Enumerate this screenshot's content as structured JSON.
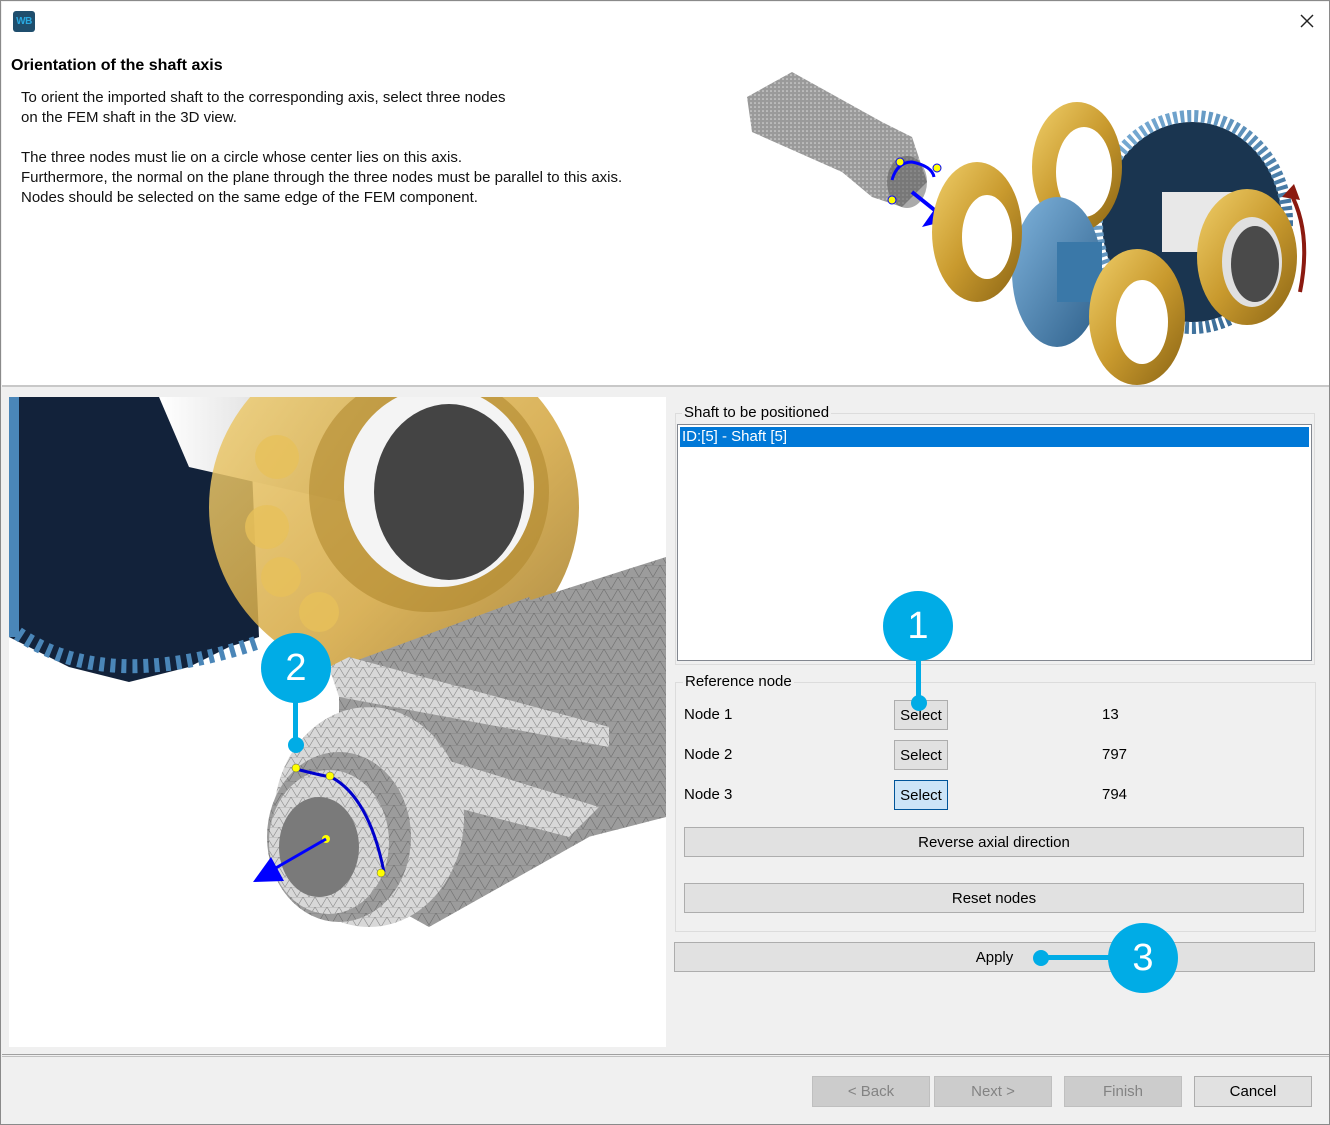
{
  "window": {
    "app_icon_text": "WB",
    "close_icon": "close-icon"
  },
  "header": {
    "title": "Orientation of the shaft axis",
    "description": [
      "To orient the imported shaft to the corresponding axis, select three nodes",
      "on the FEM shaft in the 3D view.",
      "",
      "The three nodes must lie on a circle whose center lies on this axis.",
      "Furthermore, the normal on the plane through the three nodes must be parallel to this axis.",
      "Nodes should be selected on the same edge of the FEM component."
    ]
  },
  "shaft_group": {
    "label": "Shaft to be positioned",
    "items": [
      {
        "label": "ID:[5] - Shaft [5]",
        "selected": true
      }
    ]
  },
  "reference_node": {
    "label": "Reference node",
    "nodes": [
      {
        "label": "Node 1",
        "button": "Select",
        "value": "13"
      },
      {
        "label": "Node 2",
        "button": "Select",
        "value": "797"
      },
      {
        "label": "Node 3",
        "button": "Select",
        "value": "794",
        "focused": true
      }
    ],
    "reverse_label": "Reverse axial direction",
    "reset_label": "Reset nodes"
  },
  "apply_label": "Apply",
  "footer": {
    "back_label": "< Back",
    "next_label": "Next >",
    "finish_label": "Finish",
    "cancel_label": "Cancel"
  },
  "callouts": [
    "1",
    "2",
    "3"
  ],
  "colors": {
    "accent": "#00ace6",
    "selection": "#0078d7",
    "bearing": "#d4a84a",
    "gear": "#4a86b8",
    "axis_arrow": "#0000ff",
    "node_marker": "#ffff00"
  }
}
